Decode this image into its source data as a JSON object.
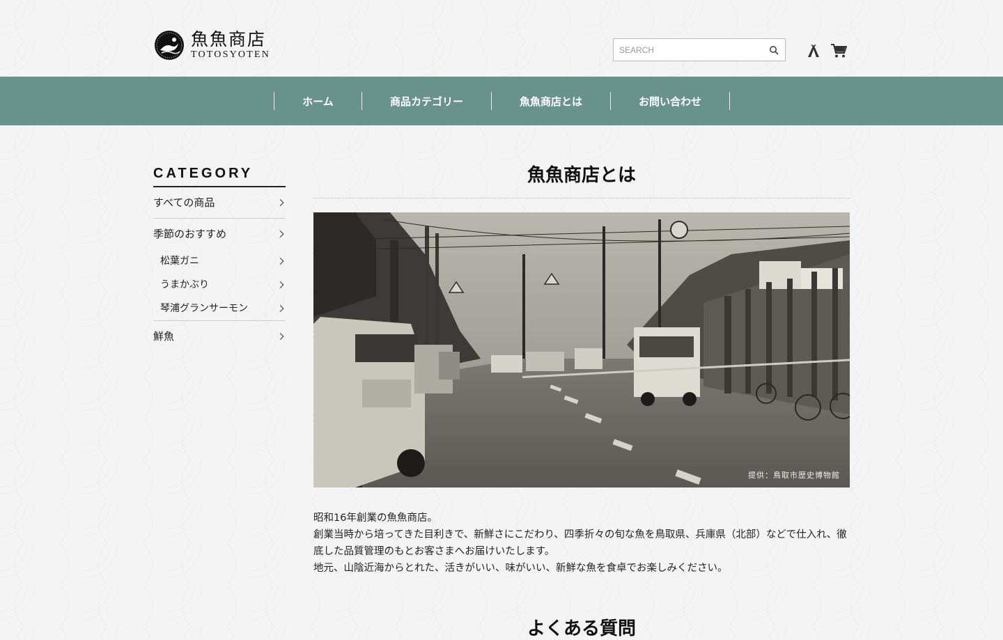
{
  "header": {
    "logo": {
      "title_jp": "魚魚商店",
      "title_en": "TOTOSYOTEN"
    },
    "search": {
      "placeholder": "SEARCH"
    },
    "icons": {
      "search": "search-icon",
      "account": "account-icon",
      "cart": "cart-icon"
    }
  },
  "nav": {
    "items": [
      {
        "label": "ホーム"
      },
      {
        "label": "商品カテゴリー"
      },
      {
        "label": "魚魚商店とは"
      },
      {
        "label": "お問い合わせ"
      }
    ]
  },
  "sidebar": {
    "title": "CATEGORY",
    "items": [
      {
        "label": "すべての商品"
      },
      {
        "label": "季節のおすすめ"
      },
      {
        "label": "松葉ガニ"
      },
      {
        "label": "うまかぶり"
      },
      {
        "label": "琴浦グランサーモン"
      },
      {
        "label": "鮮魚"
      }
    ]
  },
  "main": {
    "title": "魚魚商店とは",
    "photo_credit": "提供：鳥取市歴史博物館",
    "intro": [
      "昭和16年創業の魚魚商店。",
      "創業当時から培ってきた目利きで、新鮮さにこだわり、四季折々の旬な魚を鳥取県、兵庫県（北部）などで仕入れ、徹底した品質管理のもとお客さまへお届けいたします。",
      "地元、山陰近海からとれた、活きがいい、味がいい、新鮮な魚を食卓でお楽しみください。"
    ],
    "faq_title": "よくある質問"
  },
  "colors": {
    "nav_bg": "#6a928c",
    "text": "#222222"
  }
}
